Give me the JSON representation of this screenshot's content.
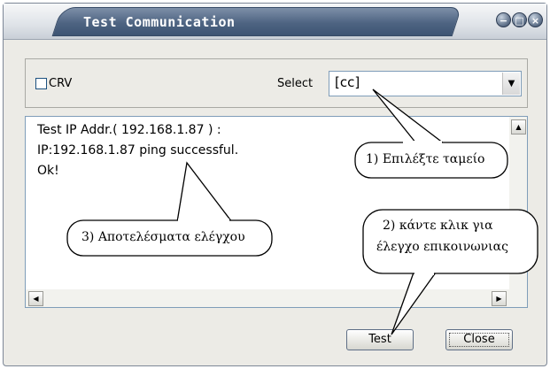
{
  "window": {
    "title": "Test Communication",
    "controls": {
      "minimize_glyph": "−",
      "maximize_glyph": "□",
      "close_glyph": "×"
    }
  },
  "options": {
    "crv_label": "CRV",
    "crv_checked": false,
    "select_label": "Select",
    "select_value": "[cc]",
    "dropdown_arrow": "▼"
  },
  "result": {
    "lines": [
      "Test IP Addr.( 192.168.1.87 ) :",
      "IP:192.168.1.87 ping successful.",
      "Ok!"
    ],
    "scroll_up_glyph": "▲",
    "scroll_left_glyph": "◀",
    "scroll_right_glyph": "▶"
  },
  "buttons": {
    "test_label": "Test",
    "close_label": "Close"
  },
  "annotations": {
    "select_callout": "1) Επιλέξτε ταμείο",
    "click_callout_line1": "2) κάντε κλικ για",
    "click_callout_line2": "έλεγχο επικοινωνιας",
    "results_callout": "3) Αποτελέσματα ελέγχου"
  }
}
